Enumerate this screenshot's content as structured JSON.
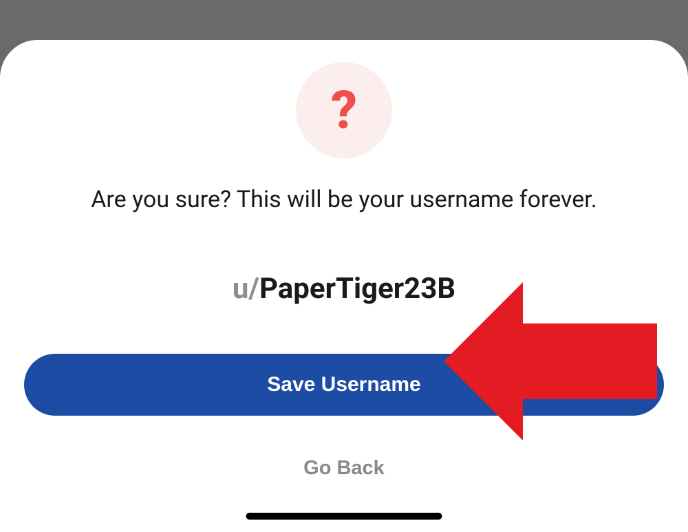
{
  "dialog": {
    "icon": "question-mark-icon",
    "message": "Are you sure? This will be your username forever.",
    "username_prefix": "u/",
    "username": "PaperTiger23B",
    "save_label": "Save Username",
    "back_label": "Go Back"
  },
  "annotation": {
    "arrow_color": "#e31b23"
  }
}
